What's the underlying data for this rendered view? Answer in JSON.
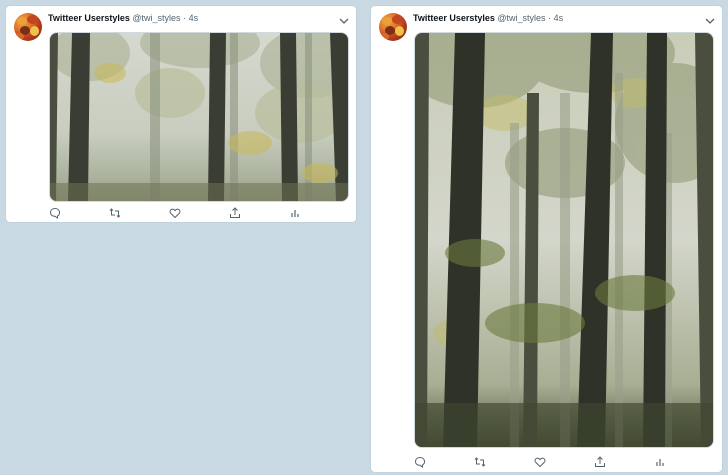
{
  "tweets": [
    {
      "author": {
        "name": "Twitteer Userstyles",
        "handle": "@twi_styles",
        "separator": "·",
        "time": "4s"
      },
      "actions": [
        "reply-icon",
        "retweet-icon",
        "like-icon",
        "share-icon",
        "analytics-icon"
      ]
    },
    {
      "author": {
        "name": "Twitteer Userstyles",
        "handle": "@twi_styles",
        "separator": "·",
        "time": "4s"
      },
      "actions": [
        "reply-icon",
        "retweet-icon",
        "like-icon",
        "share-icon",
        "analytics-icon"
      ]
    }
  ],
  "colors": {
    "page_background": "#c9d9e4",
    "card_background": "#ffffff",
    "text_primary": "#0f1419",
    "text_secondary": "#536471",
    "icon": "#536471"
  }
}
